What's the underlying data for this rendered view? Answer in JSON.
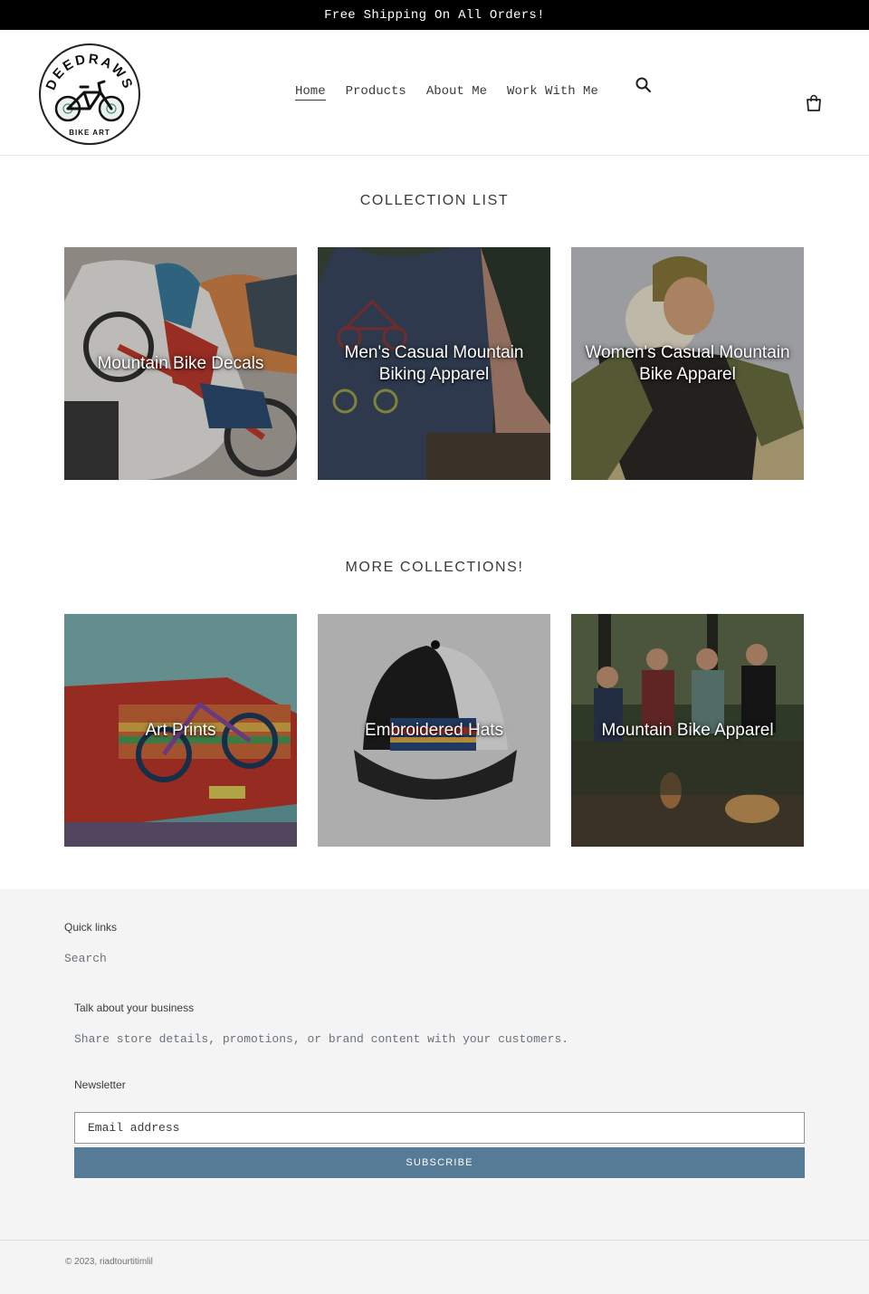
{
  "announcement": {
    "text": "Free Shipping On All Orders!"
  },
  "header": {
    "logo": {
      "name": "DEEDRAWS",
      "tagline": "BIKE ART"
    },
    "nav": [
      {
        "label": "Home",
        "active": true
      },
      {
        "label": "Products",
        "active": false
      },
      {
        "label": "About Me",
        "active": false
      },
      {
        "label": "Work With Me",
        "active": false
      }
    ],
    "icons": {
      "search": "search-icon",
      "cart": "cart-icon"
    }
  },
  "collection_list": {
    "title": "COLLECTION LIST",
    "items": [
      {
        "label": "Mountain Bike Decals"
      },
      {
        "label": "Men's Casual Mountain Biking Apparel"
      },
      {
        "label": "Women's Casual Mountain Bike Apparel"
      }
    ]
  },
  "more_collections": {
    "title": "MORE COLLECTIONS!",
    "items": [
      {
        "label": "Art Prints"
      },
      {
        "label": "Embroidered Hats"
      },
      {
        "label": "Mountain Bike Apparel"
      }
    ]
  },
  "footer": {
    "quick_links": {
      "heading": "Quick links",
      "links": [
        {
          "label": "Search"
        }
      ]
    },
    "business": {
      "heading": "Talk about your business",
      "text": "Share store details, promotions, or brand content with your customers."
    },
    "newsletter": {
      "heading": "Newsletter",
      "placeholder": "Email address",
      "button": "SUBSCRIBE"
    },
    "copyright": "© 2023, riadtourtitimlil"
  },
  "colors": {
    "announcement_bg": "#000000",
    "accent": "#557b97",
    "footer_bg": "#f4f4f4"
  }
}
